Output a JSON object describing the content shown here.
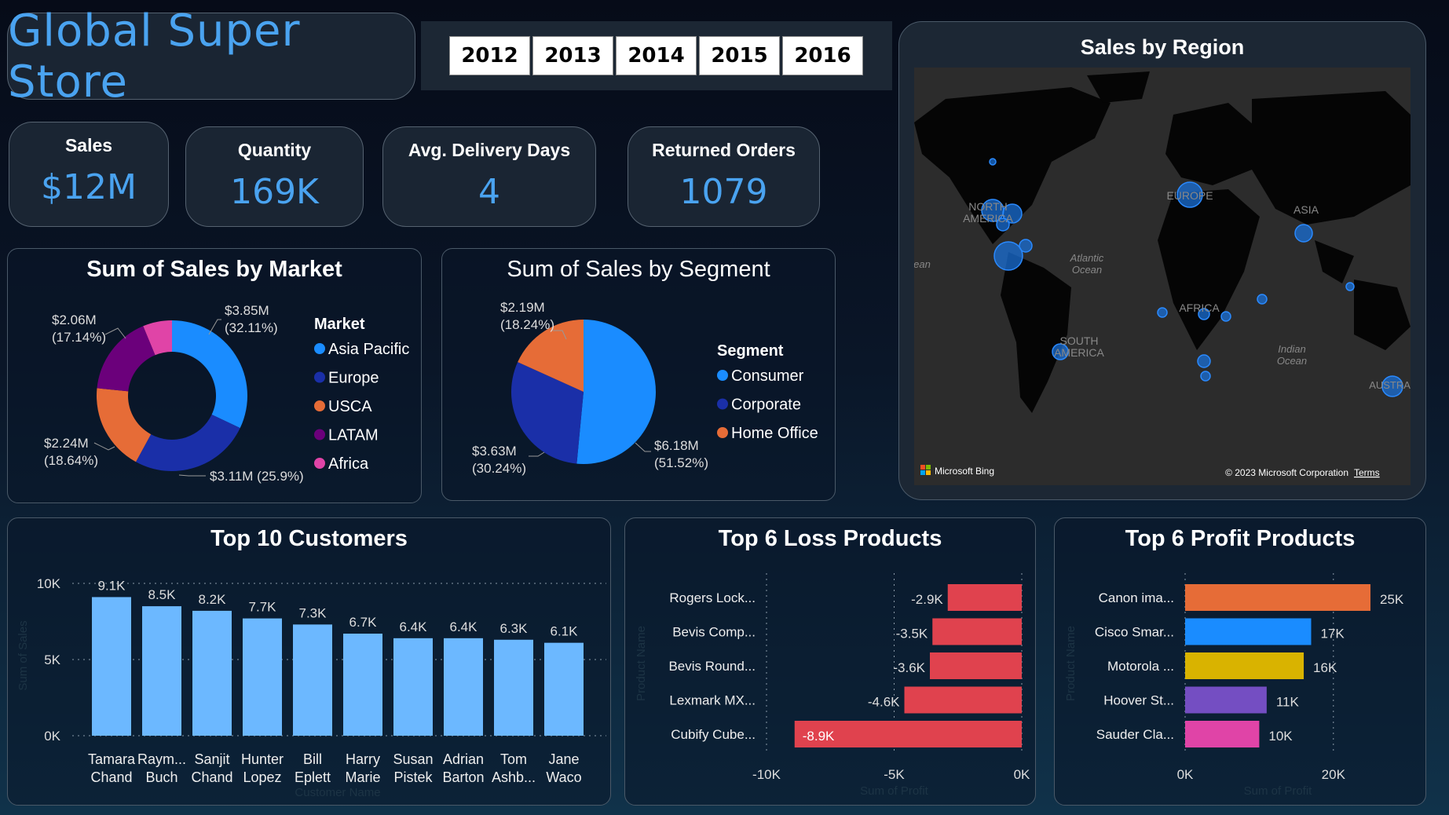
{
  "header": {
    "title": "Global Super Store",
    "years": [
      "2012",
      "2013",
      "2014",
      "2015",
      "2016"
    ]
  },
  "kpis": {
    "sales": {
      "label": "Sales",
      "value": "$12M"
    },
    "quantity": {
      "label": "Quantity",
      "value": "169K"
    },
    "delivery": {
      "label": "Avg. Delivery Days",
      "value": "4"
    },
    "returns": {
      "label": "Returned Orders",
      "value": "1079"
    }
  },
  "map": {
    "title": "Sales by Region",
    "labels": [
      "NORTH AMERICA",
      "EUROPE",
      "ASIA",
      "Atlantic Ocean",
      "AFRICA",
      "SOUTH AMERICA",
      "Indian Ocean",
      "AUSTRALI",
      "ean"
    ],
    "bing": "Microsoft Bing",
    "copyright": "© 2023 Microsoft Corporation",
    "terms": "Terms"
  },
  "colors": {
    "accent": "#4aa3f0",
    "bar_blue": "#6cb8ff",
    "loss_red": "#e0424e"
  },
  "chart_data": [
    {
      "id": "market",
      "type": "pie",
      "title": "Sum of Sales by Market",
      "legend_title": "Market",
      "labels": [
        "Asia Pacific",
        "Europe",
        "USCA",
        "LATAM",
        "Africa"
      ],
      "values": [
        3.85,
        3.11,
        2.24,
        2.06,
        0.75
      ],
      "percents": [
        32.11,
        25.9,
        18.64,
        17.14,
        6.21
      ],
      "data_labels": [
        [
          "$3.85M",
          "(32.11%)"
        ],
        [
          "$3.11M (25.9%)"
        ],
        [
          "$2.24M",
          "(18.64%)"
        ],
        [
          "$2.06M",
          "(17.14%)"
        ]
      ],
      "colors": [
        "#1a8cff",
        "#1a2fa8",
        "#e66c37",
        "#6b007b",
        "#e044a7"
      ],
      "donut": true,
      "legend_position": "right"
    },
    {
      "id": "segment",
      "type": "pie",
      "title": "Sum of Sales by Segment",
      "legend_title": "Segment",
      "labels": [
        "Consumer",
        "Corporate",
        "Home Office"
      ],
      "values": [
        6.18,
        3.63,
        2.19
      ],
      "percents": [
        51.52,
        30.24,
        18.24
      ],
      "data_labels": [
        [
          "$6.18M",
          "(51.52%)"
        ],
        [
          "$3.63M",
          "(30.24%)"
        ],
        [
          "$2.19M",
          "(18.24%)"
        ]
      ],
      "colors": [
        "#1a8cff",
        "#1a2fa8",
        "#e66c37"
      ],
      "legend_position": "right"
    },
    {
      "id": "customers",
      "type": "bar",
      "title": "Top 10 Customers",
      "categories": [
        [
          "Tamara",
          "Chand"
        ],
        [
          "Raym...",
          "Buch"
        ],
        [
          "Sanjit",
          "Chand"
        ],
        [
          "Hunter",
          "Lopez"
        ],
        [
          "Bill",
          "Eplett"
        ],
        [
          "Harry",
          "Marie"
        ],
        [
          "Susan",
          "Pistek"
        ],
        [
          "Adrian",
          "Barton"
        ],
        [
          "Tom",
          "Ashb..."
        ],
        [
          "Jane",
          "Waco"
        ]
      ],
      "values": [
        9.1,
        8.5,
        8.2,
        7.7,
        7.3,
        6.7,
        6.4,
        6.4,
        6.3,
        6.1
      ],
      "value_labels": [
        "9.1K",
        "8.5K",
        "8.2K",
        "7.7K",
        "7.3K",
        "6.7K",
        "6.4K",
        "6.4K",
        "6.3K",
        "6.1K"
      ],
      "yticks": [
        "0K",
        "5K",
        "10K"
      ],
      "ylim": [
        0,
        10
      ],
      "xlabel": "Customer Name",
      "ylabel": "Sum of Sales",
      "grid": true
    },
    {
      "id": "loss",
      "type": "bar",
      "orientation": "horizontal",
      "title": "Top 6 Loss Products",
      "categories": [
        "Rogers Lock...",
        "Bevis Comp...",
        "Bevis Round...",
        "Lexmark MX...",
        "Cubify Cube..."
      ],
      "values": [
        -2.9,
        -3.5,
        -3.6,
        -4.6,
        -8.9
      ],
      "value_labels": [
        "-2.9K",
        "-3.5K",
        "-3.6K",
        "-4.6K",
        "-8.9K"
      ],
      "xticks": [
        "-10K",
        "-5K",
        "0K"
      ],
      "xlim": [
        -10,
        0
      ],
      "xlabel": "Sum of Profit",
      "ylabel": "Product Name",
      "grid": true
    },
    {
      "id": "profit",
      "type": "bar",
      "orientation": "horizontal",
      "title": "Top 6 Profit Products",
      "categories": [
        "Canon ima...",
        "Cisco Smar...",
        "Motorola ...",
        "Hoover St...",
        "Sauder Cla..."
      ],
      "values": [
        25,
        17,
        16,
        11,
        10
      ],
      "value_labels": [
        "25K",
        "17K",
        "16K",
        "11K",
        "10K"
      ],
      "colors": [
        "#e66c37",
        "#1a8cff",
        "#d9b300",
        "#744ec2",
        "#e044a7"
      ],
      "xticks": [
        "0K",
        "20K"
      ],
      "xlim": [
        0,
        25
      ],
      "xlabel": "Sum of Profit",
      "ylabel": "Product Name",
      "grid": true
    }
  ]
}
